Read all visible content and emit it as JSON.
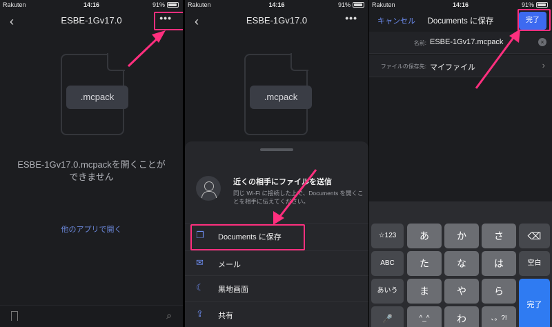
{
  "status": {
    "carrier": "Rakuten",
    "time": "14:16",
    "battery": "91%"
  },
  "panel1": {
    "title": "ESBE-1Gv17.0",
    "more_icon": "•••",
    "file_ext": ".mcpack",
    "cannot_open": "ESBE-1Gv17.0.mcpackを開くことができません",
    "open_other_app": "他のアプリで開く"
  },
  "panel2": {
    "title": "ESBE-1Gv17.0",
    "more_icon": "•••",
    "file_ext": ".mcpack",
    "nearby_title": "近くの相手にファイルを送信",
    "nearby_desc": "同じ Wi-Fi に接続した上で、Documents を開くことを相手に伝えてください。",
    "actions": [
      {
        "label": "Documents に保存",
        "icon": "copy-icon"
      },
      {
        "label": "メール",
        "icon": "mail-icon"
      },
      {
        "label": "黒地画面",
        "icon": "moon-icon"
      },
      {
        "label": "共有",
        "icon": "share-icon"
      }
    ]
  },
  "panel3": {
    "cancel": "キャンセル",
    "title": "Documents に保存",
    "done": "完了",
    "name_label": "名前:",
    "name_value": "ESBE-1Gv17.mcpack",
    "dest_label": "ファイルの保存先:",
    "dest_value": "マイファイル",
    "keyboard": {
      "row1": [
        "☆123",
        "あ",
        "か",
        "さ",
        "⌫"
      ],
      "row2": [
        "ABC",
        "た",
        "な",
        "は",
        "空白"
      ],
      "row3": [
        "あいう",
        "ま",
        "や",
        "ら",
        "完了"
      ],
      "row4": [
        "🎤",
        "^_^",
        "わ",
        "、。?!"
      ]
    }
  },
  "colors": {
    "accent": "#6d8cf0",
    "highlight": "#ff2f7e",
    "done_bg": "#3d6af0"
  }
}
